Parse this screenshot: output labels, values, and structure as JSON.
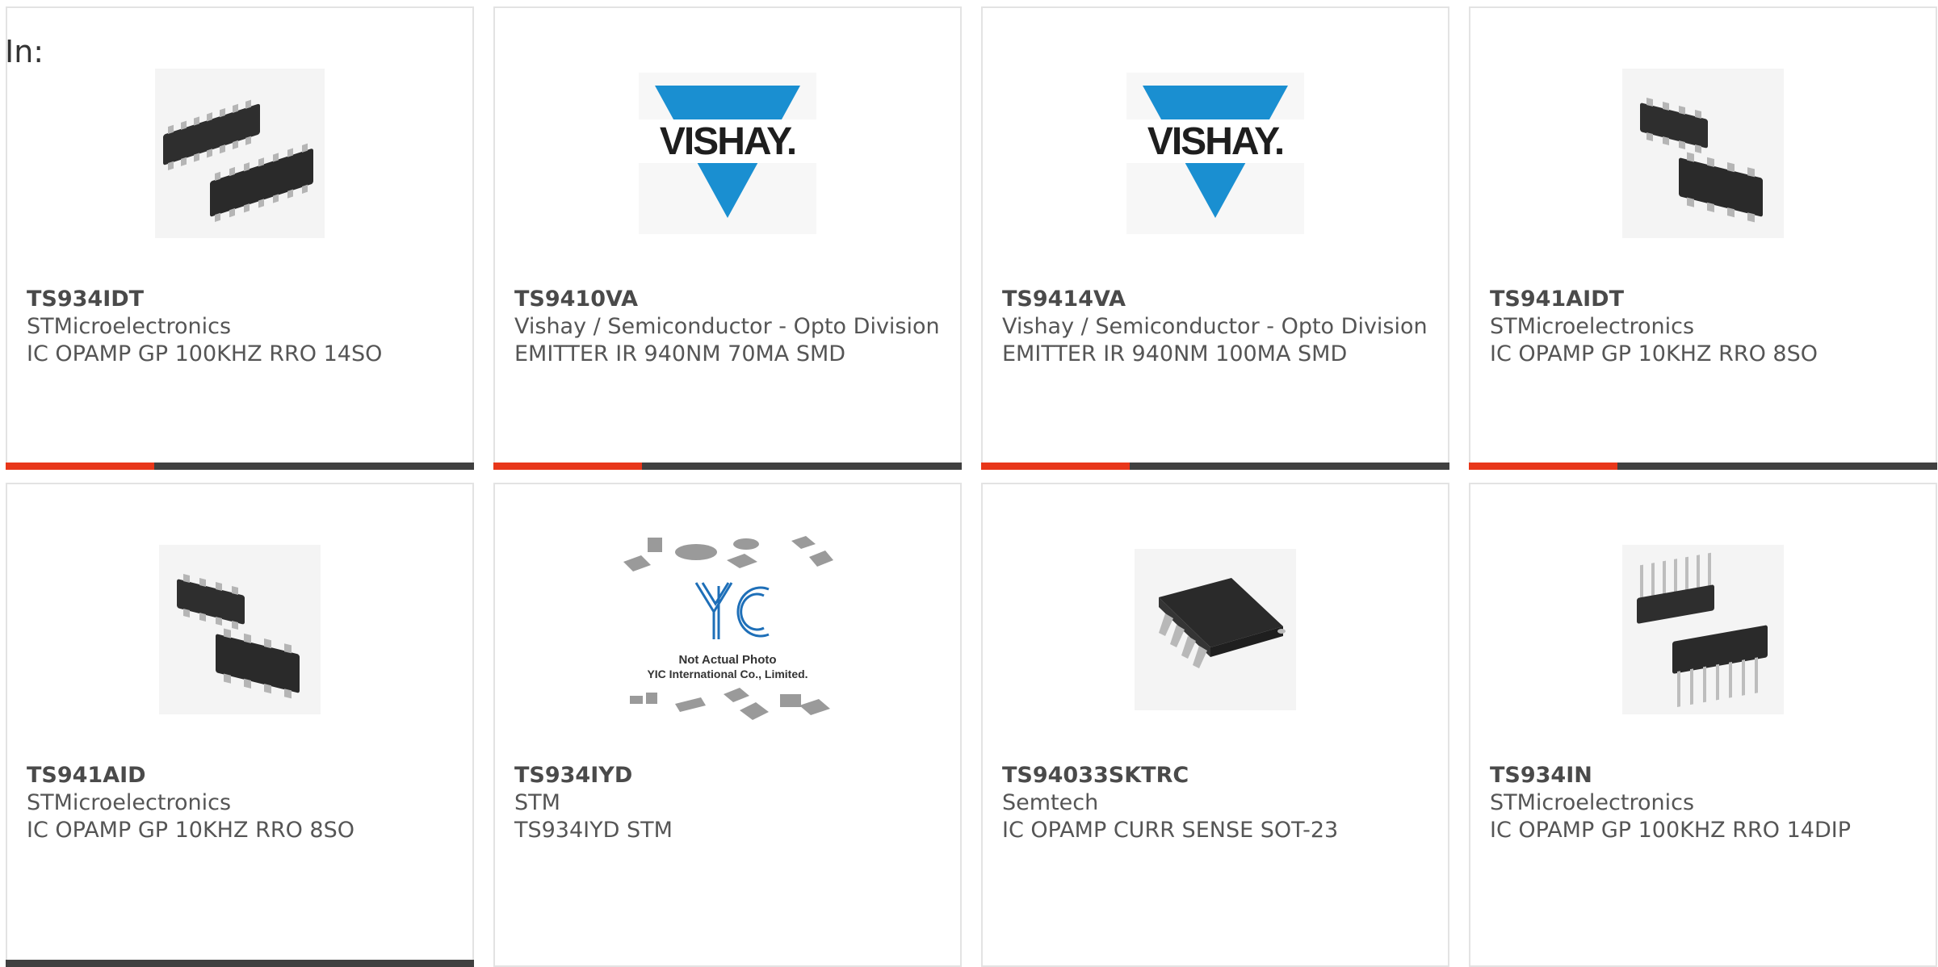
{
  "header": {
    "in_label": "In:"
  },
  "colors": {
    "accent": "#e8371a",
    "bar": "#404040",
    "vishay_blue": "#1a8fd1"
  },
  "products": [
    {
      "part_number": "TS934IDT",
      "manufacturer": "STMicroelectronics",
      "description": "IC OPAMP GP 100KHZ RRO 14SO",
      "image": "soic-14-pair-icon"
    },
    {
      "part_number": "TS9410VA",
      "manufacturer": "Vishay / Semiconductor - Opto Division",
      "description": "EMITTER IR 940NM 70MA SMD",
      "image": "vishay-logo",
      "logo_text": "VISHAY."
    },
    {
      "part_number": "TS9414VA",
      "manufacturer": "Vishay / Semiconductor - Opto Division",
      "description": "EMITTER IR 940NM 100MA SMD",
      "image": "vishay-logo",
      "logo_text": "VISHAY."
    },
    {
      "part_number": "TS941AIDT",
      "manufacturer": "STMicroelectronics",
      "description": "IC OPAMP GP 10KHZ RRO 8SO",
      "image": "soic-8-pair-icon"
    },
    {
      "part_number": "TS941AID",
      "manufacturer": "STMicroelectronics",
      "description": "IC OPAMP GP 10KHZ RRO 8SO",
      "image": "soic-8-pair-icon"
    },
    {
      "part_number": "TS934IYD",
      "manufacturer": "STM",
      "description": "TS934IYD STM",
      "image": "yic-placeholder",
      "placeholder_line1": "Not Actual Photo",
      "placeholder_line2": "YIC International Co., Limited."
    },
    {
      "part_number": "TS94033SKTRC",
      "manufacturer": "Semtech",
      "description": "IC OPAMP CURR SENSE SOT-23",
      "image": "soic-8-single-icon"
    },
    {
      "part_number": "TS934IN",
      "manufacturer": "STMicroelectronics",
      "description": "IC OPAMP GP 100KHZ RRO 14DIP",
      "image": "dip-14-pair-icon"
    }
  ]
}
